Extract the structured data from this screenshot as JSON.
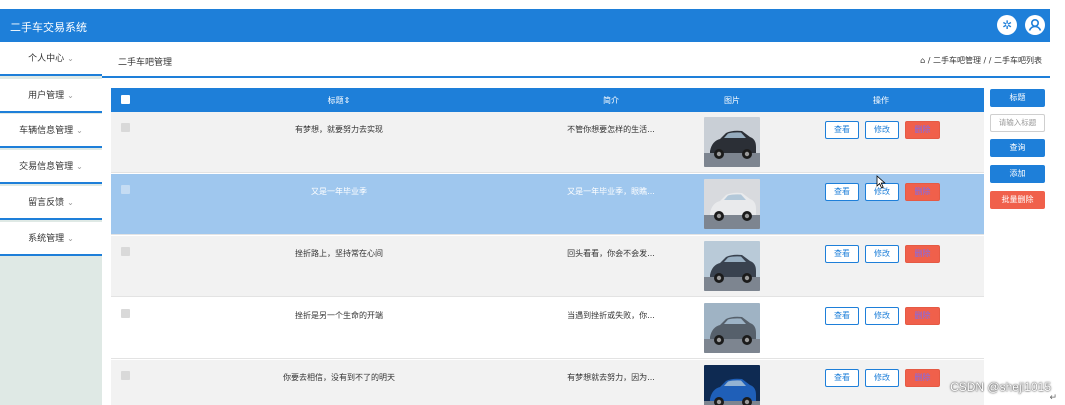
{
  "crop_text": "",
  "header": {
    "title": "二手车交易系统"
  },
  "sidebar": [
    "个人中心",
    "用户管理",
    "车辆信息管理",
    "交易信息管理",
    "留言反馈",
    "系统管理"
  ],
  "page": {
    "title": "二手车吧管理",
    "breadcrumb_1": "/ 二手车吧管理 /",
    "breadcrumb_2": "二手车吧列表"
  },
  "table": {
    "columns": [
      "标题⇕",
      "简介",
      "图片",
      "操作"
    ],
    "rows": [
      {
        "title": "有梦想，就要努力去实现",
        "intro": "不管你想要怎样的生活...",
        "style": "alt",
        "car_color": "#2b2f36",
        "sky": "#c9cfd6"
      },
      {
        "title": "又是一年毕业季",
        "intro": "又是一年毕业季，眼瞧...",
        "style": "sel",
        "car_color": "#e9eaec",
        "sky": "#d8dade"
      },
      {
        "title": "挫折路上，坚持常在心间",
        "intro": "回头看看，你会不会发...",
        "style": "alt",
        "car_color": "#39424f",
        "sky": "#b9cad8"
      },
      {
        "title": "挫折是另一个生命的开端",
        "intro": "当遇到挫折或失败，你...",
        "style": "white",
        "car_color": "#56606b",
        "sky": "#9fb3c4"
      },
      {
        "title": "你要去相信，没有到不了的明天",
        "intro": "有梦想就去努力，因为...",
        "style": "alt",
        "car_color": "#1f5fb8",
        "sky": "#0e2a52"
      }
    ],
    "actions": {
      "view": "查看",
      "edit": "修改",
      "delete": "删除"
    }
  },
  "toolbar": {
    "filter_label": "标题",
    "input_placeholder": "请输入标题",
    "search": "查询",
    "add": "添加",
    "batch_delete": "批量删除"
  },
  "watermark": "CSDN @sheji1015",
  "corner_mark": "↵",
  "colors": {
    "primary": "#1e7fd9",
    "danger": "#f0604b",
    "selected_row": "#9fc7ee"
  }
}
